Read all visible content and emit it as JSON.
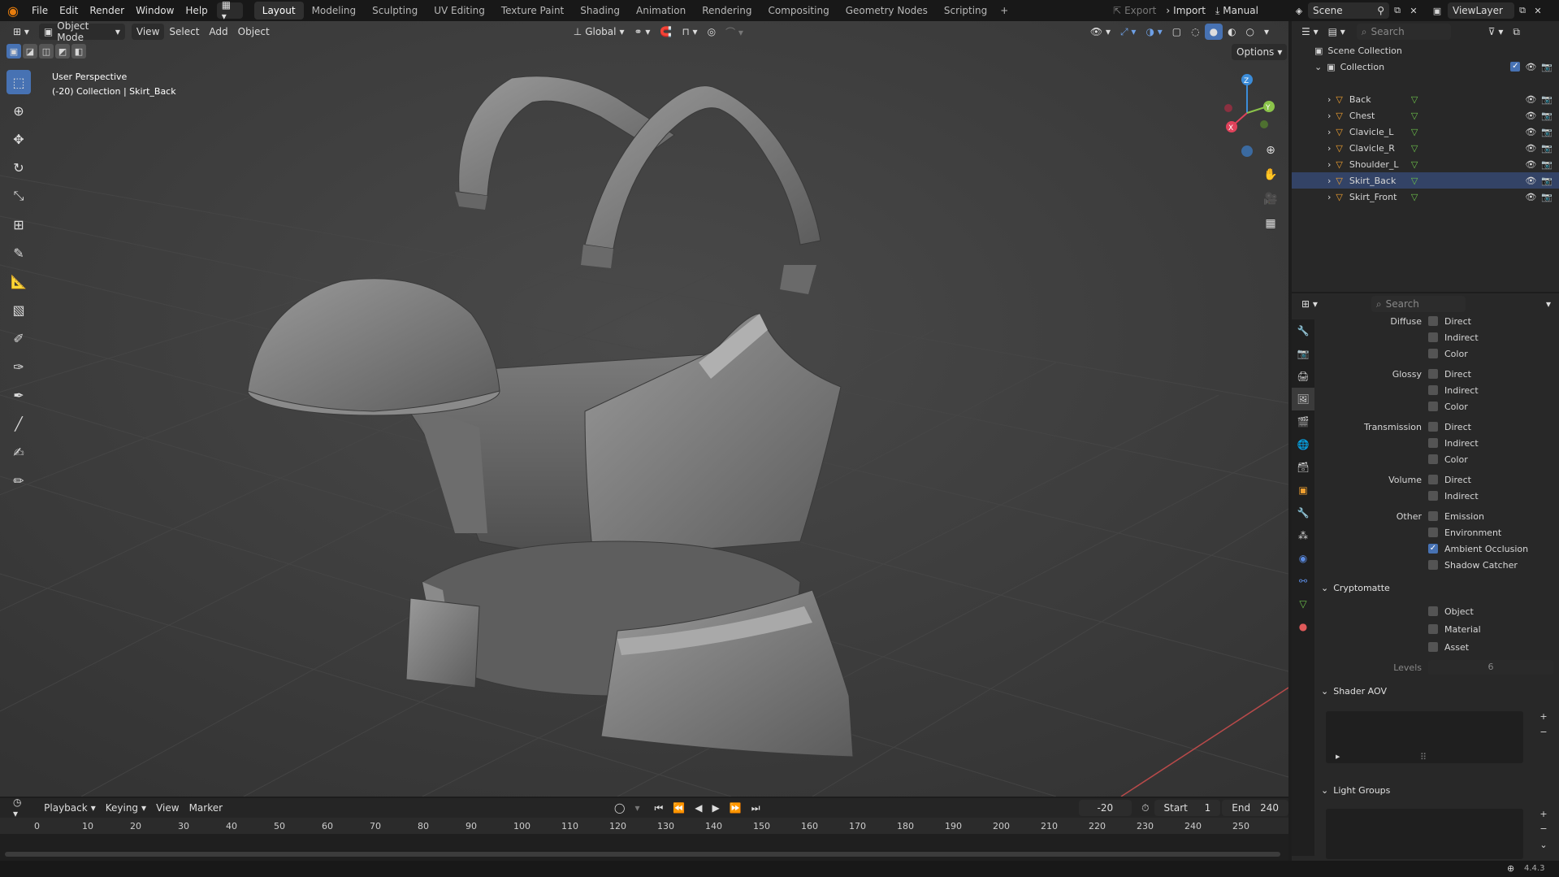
{
  "menu": {
    "items": [
      "File",
      "Edit",
      "Render",
      "Window",
      "Help"
    ],
    "workspace_tabs": [
      "Layout",
      "Modeling",
      "Sculpting",
      "UV Editing",
      "Texture Paint",
      "Shading",
      "Animation",
      "Rendering",
      "Compositing",
      "Geometry Nodes",
      "Scripting"
    ],
    "active_tab": "Layout",
    "export_label": "Export",
    "import_label": "Import",
    "manual_label": "Manual",
    "scene_label": "Scene",
    "viewlayer_label": "ViewLayer"
  },
  "viewport": {
    "mode": "Object Mode",
    "menus": [
      "View",
      "Select",
      "Add",
      "Object"
    ],
    "orientation": "Global",
    "options_label": "Options",
    "perspective_label": "User Perspective",
    "collection_info": "(-20) Collection | Skirt_Back",
    "gizmo": {
      "x": "X",
      "y": "Y",
      "z": "Z"
    }
  },
  "outliner": {
    "search_placeholder": "Search",
    "scene_collection": "Scene Collection",
    "collection": "Collection",
    "objects": [
      "Back",
      "Chest",
      "Clavicle_L",
      "Clavicle_R",
      "Shoulder_L",
      "Skirt_Back",
      "Skirt_Front"
    ],
    "active_object": "Skirt_Back"
  },
  "properties": {
    "search_placeholder": "Search",
    "passes": {
      "diffuse": {
        "label": "Diffuse",
        "items": [
          "Direct",
          "Indirect",
          "Color"
        ]
      },
      "glossy": {
        "label": "Glossy",
        "items": [
          "Direct",
          "Indirect",
          "Color"
        ]
      },
      "transmission": {
        "label": "Transmission",
        "items": [
          "Direct",
          "Indirect",
          "Color"
        ]
      },
      "volume": {
        "label": "Volume",
        "items": [
          "Direct",
          "Indirect"
        ]
      },
      "other": {
        "label": "Other",
        "items": [
          "Emission",
          "Environment",
          "Ambient Occlusion",
          "Shadow Catcher"
        ],
        "checked": "Ambient Occlusion"
      }
    },
    "cryptomatte": {
      "title": "Cryptomatte",
      "items": [
        "Object",
        "Material",
        "Asset"
      ],
      "levels_label": "Levels",
      "levels_value": "6"
    },
    "shader_aov": {
      "title": "Shader AOV"
    },
    "light_groups": {
      "title": "Light Groups"
    }
  },
  "timeline": {
    "menus": [
      "Playback",
      "Keying",
      "View",
      "Marker"
    ],
    "current_frame": "-20",
    "start_label": "Start",
    "start_value": "1",
    "end_label": "End",
    "end_value": "240",
    "ruler": [
      "0",
      "10",
      "20",
      "30",
      "40",
      "50",
      "60",
      "70",
      "80",
      "90",
      "100",
      "110",
      "120",
      "130",
      "140",
      "150",
      "160",
      "170",
      "180",
      "190",
      "200",
      "210",
      "220",
      "230",
      "240",
      "250"
    ]
  },
  "status": {
    "version": "4.4.3"
  },
  "colors": {
    "accent": "#4772b3",
    "x_axis": "#e0425b",
    "y_axis": "#8bc34a",
    "z_axis": "#3b8cd9",
    "mesh": "#808080"
  }
}
